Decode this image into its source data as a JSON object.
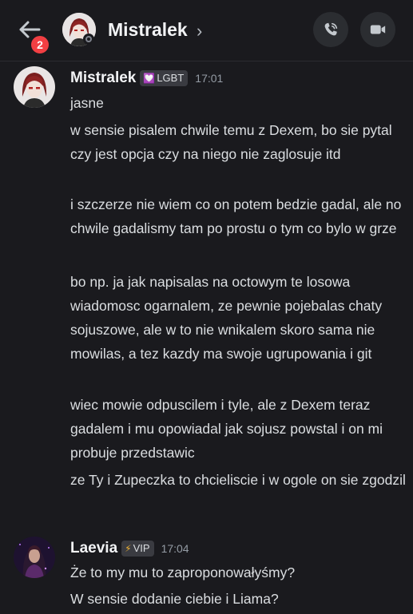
{
  "header": {
    "back_badge": "2",
    "channel_name": "Mistralek",
    "chevron": "›"
  },
  "messages": [
    {
      "author": "Mistralek",
      "tag": "LGBT",
      "tag_icon": "heart-icon",
      "time": "17:01",
      "lines": [
        "jasne",
        "w sensie pisalem chwile temu z Dexem, bo sie pytal czy jest opcja czy na niego nie zaglosuje itd",
        "i szczerze nie wiem co on potem bedzie gadal, ale no chwile gadalismy tam po prostu o tym co bylo w grze",
        "bo np. ja jak napisalas na octowym te losowa wiadomosc ogarnalem, ze pewnie pojebalas chaty sojuszowe, ale w to nie wnikalem skoro sama nie mowilas, a tez kazdy ma swoje ugrupowania i git",
        "wiec mowie odpuscilem i tyle, ale z Dexem teraz gadalem i mu opowiadal jak sojusz powstal i on mi probuje przedstawic",
        "ze Ty i Zupeczka to chcieliscie i w ogole on sie zgodzil"
      ]
    },
    {
      "author": "Laevia",
      "tag": "VIP",
      "tag_icon": "lightning-icon",
      "time": "17:04",
      "lines": [
        "Że to my mu to zaproponowałyśmy?",
        "W sensie dodanie ciebie i Liama?"
      ]
    }
  ]
}
